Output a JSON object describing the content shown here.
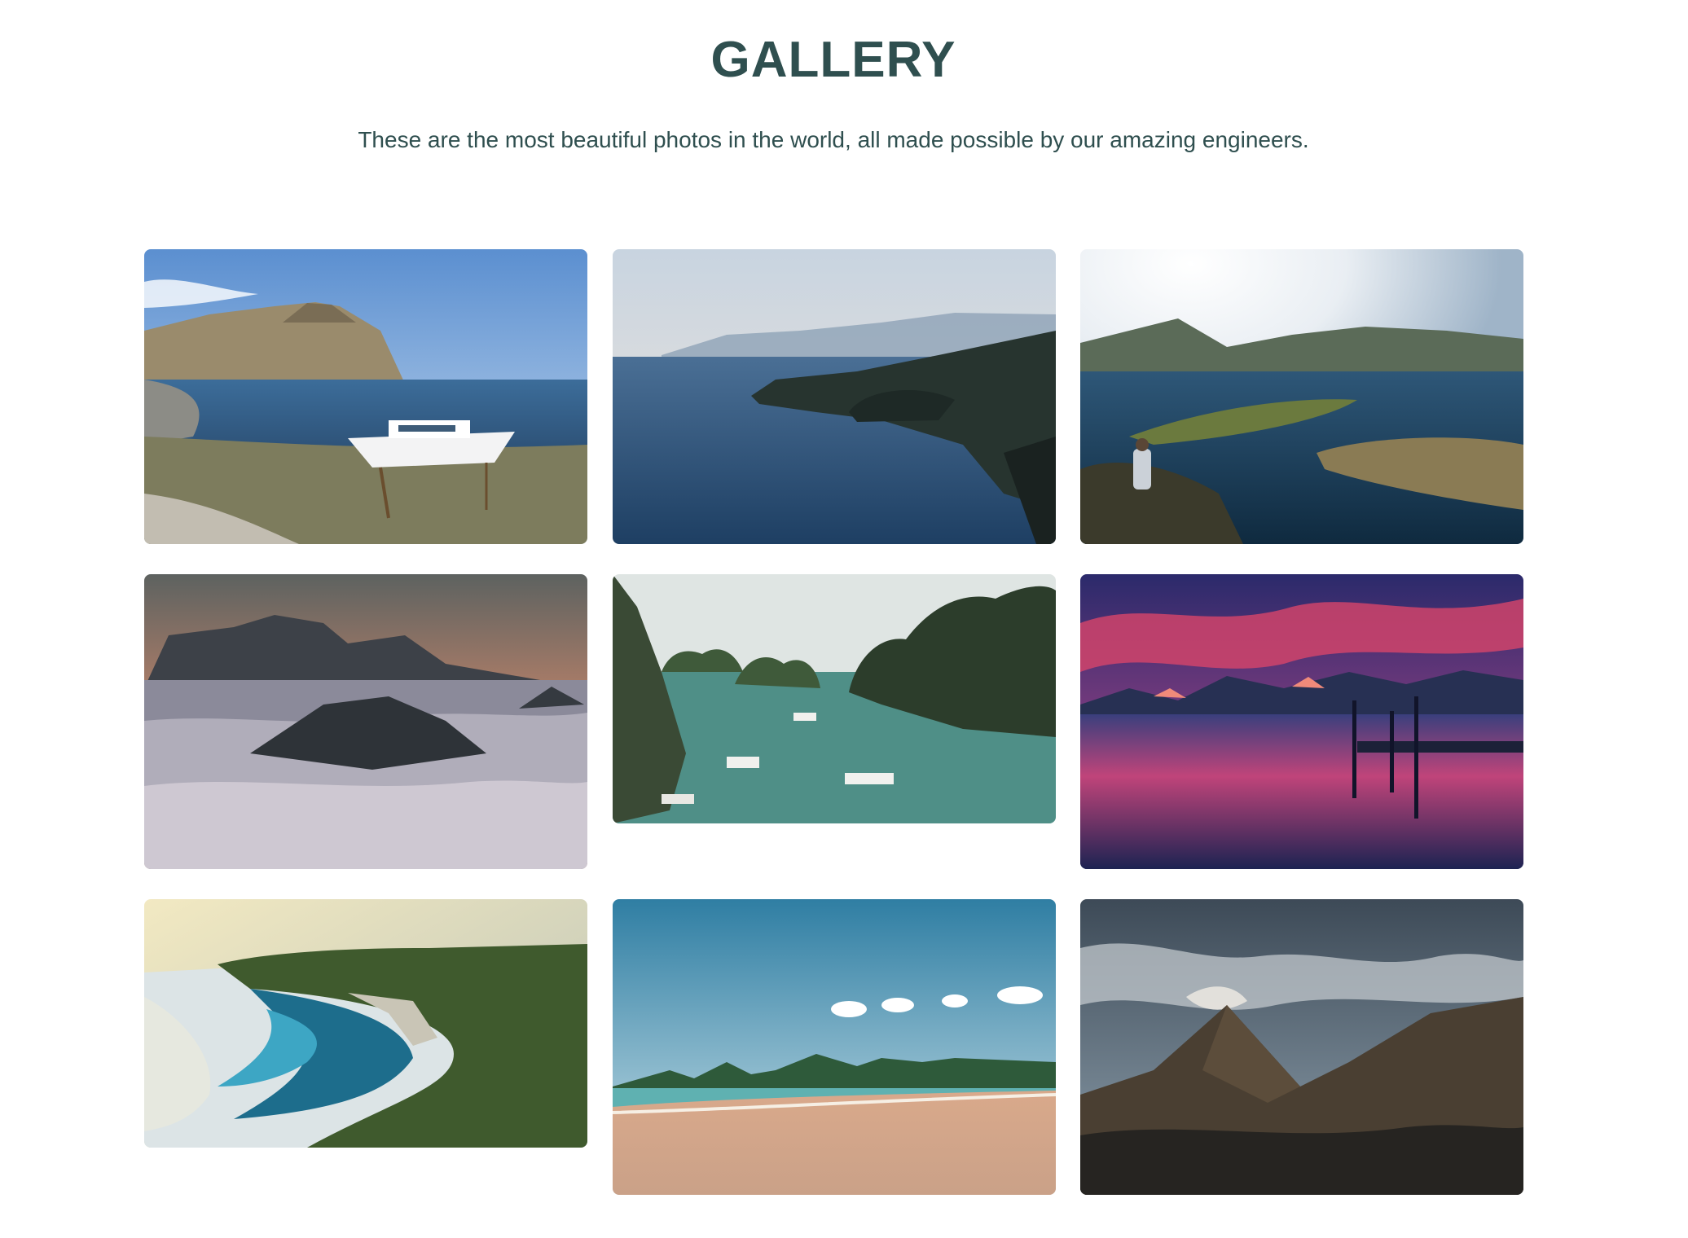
{
  "header": {
    "title": "GALLERY",
    "subtitle": "These are the most beautiful photos in the world, all made possible by our amazing engineers."
  },
  "gallery": {
    "photos": [
      {
        "subject": "boat on shore by a bay with rocky hill"
      },
      {
        "subject": "misty coastal cliffs over deep blue sea"
      },
      {
        "subject": "hiker overlooking fjord and islands at sunrise"
      },
      {
        "subject": "rocky peaks above a sea of clouds at dusk"
      },
      {
        "subject": "karst islands with boats in a green bay"
      },
      {
        "subject": "mountain lake with pier under a fiery sky"
      },
      {
        "subject": "aerial view of green cliffs and turquoise cove"
      },
      {
        "subject": "sandy beach with green hills and blue sky"
      },
      {
        "subject": "dark volcanic mountain peaks under cloudy sky"
      }
    ]
  },
  "colors": {
    "text": "#2f4f4f",
    "background": "#ffffff"
  }
}
